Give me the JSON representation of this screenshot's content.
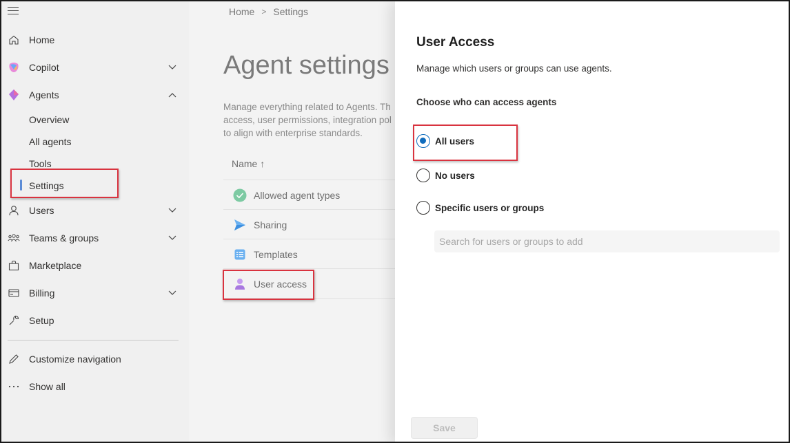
{
  "sidebar": {
    "items": [
      {
        "label": "Home",
        "icon": "home-icon"
      },
      {
        "label": "Copilot",
        "icon": "copilot-icon"
      },
      {
        "label": "Agents",
        "icon": "agents-icon"
      },
      {
        "label": "Users",
        "icon": "user-icon"
      },
      {
        "label": "Teams & groups",
        "icon": "teams-icon"
      },
      {
        "label": "Marketplace",
        "icon": "marketplace-icon"
      },
      {
        "label": "Billing",
        "icon": "billing-icon"
      },
      {
        "label": "Setup",
        "icon": "wrench-icon"
      },
      {
        "label": "Customize navigation",
        "icon": "pencil-icon"
      },
      {
        "label": "Show all",
        "icon": "ellipsis-icon"
      }
    ],
    "agents_sub": [
      "Overview",
      "All agents",
      "Tools",
      "Settings"
    ],
    "selected_sub": "Settings"
  },
  "breadcrumb": {
    "home": "Home",
    "current": "Settings",
    "separator": ">"
  },
  "main": {
    "title": "Agent settings",
    "description": "Manage everything related to Agents. Th access, user permissions, integration pol to align with enterprise standards.",
    "desc_lines": [
      "Manage everything related to Agents. Th",
      "access, user permissions, integration pol",
      "to align with enterprise standards."
    ],
    "column_header": "Name ↑",
    "rows": [
      {
        "label": "Allowed agent types",
        "icon": "check-circle-icon"
      },
      {
        "label": "Sharing",
        "icon": "send-icon"
      },
      {
        "label": "Templates",
        "icon": "list-icon"
      },
      {
        "label": "User access",
        "icon": "person-icon"
      }
    ]
  },
  "panel": {
    "title": "User Access",
    "subtitle": "Manage which users or groups can use agents.",
    "choose_label": "Choose who can access agents",
    "options": [
      {
        "label": "All users",
        "selected": true
      },
      {
        "label": "No users",
        "selected": false
      },
      {
        "label": "Specific users or groups",
        "selected": false
      }
    ],
    "search_placeholder": "Search for users or groups to add",
    "save_label": "Save"
  },
  "colors": {
    "accent": "#0f6cbd",
    "highlight": "#d9333f",
    "selection_bar": "#5b8bd6"
  }
}
